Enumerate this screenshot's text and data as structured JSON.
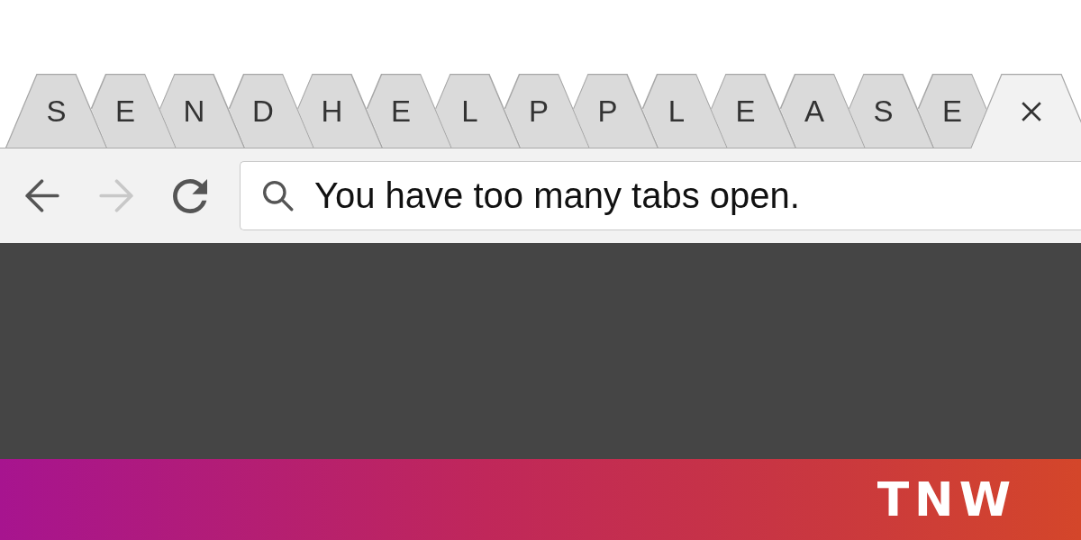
{
  "tabs": [
    {
      "label": "S",
      "selected": false
    },
    {
      "label": "E",
      "selected": false
    },
    {
      "label": "N",
      "selected": false
    },
    {
      "label": "D",
      "selected": false
    },
    {
      "label": "H",
      "selected": false
    },
    {
      "label": "E",
      "selected": false
    },
    {
      "label": "L",
      "selected": false
    },
    {
      "label": "P",
      "selected": false
    },
    {
      "label": "P",
      "selected": false
    },
    {
      "label": "L",
      "selected": false
    },
    {
      "label": "E",
      "selected": false
    },
    {
      "label": "A",
      "selected": false
    },
    {
      "label": "S",
      "selected": false
    },
    {
      "label": "E",
      "selected": false
    },
    {
      "selected": true
    }
  ],
  "toolbar": {
    "buttons": [
      {
        "kind": "back",
        "disabled": false
      },
      {
        "kind": "forward",
        "disabled": true
      },
      {
        "kind": "reload",
        "disabled": false
      }
    ],
    "address_bar": {
      "value": "You have too many tabs open."
    }
  },
  "banner": {
    "logo": "TNW"
  }
}
